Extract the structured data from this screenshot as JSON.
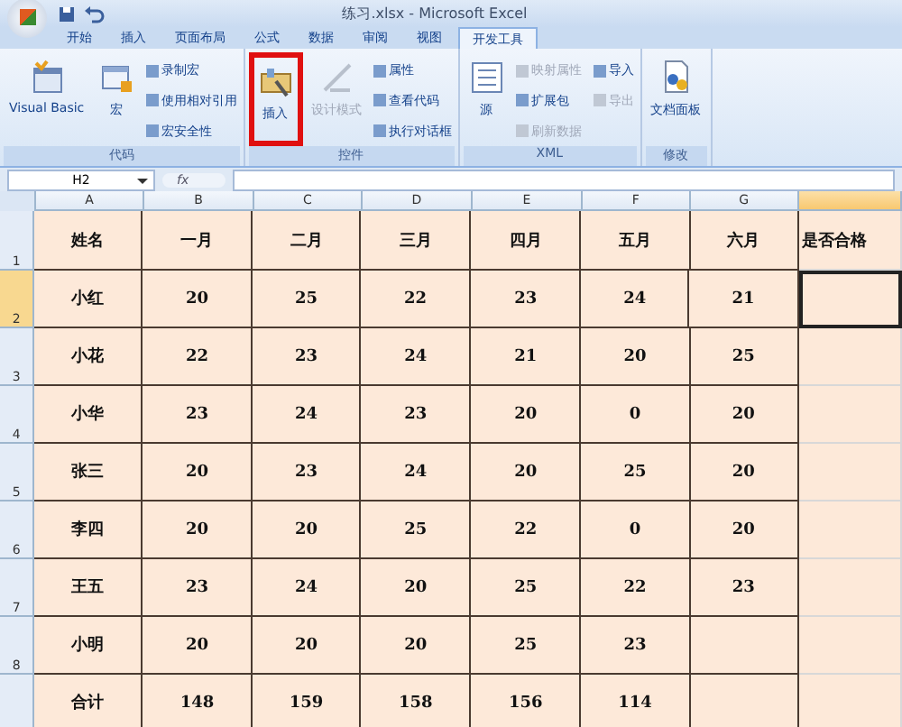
{
  "window": {
    "title": "练习.xlsx - Microsoft Excel"
  },
  "tabs": [
    {
      "label": "开始",
      "selected": false
    },
    {
      "label": "插入",
      "selected": false
    },
    {
      "label": "页面布局",
      "selected": false
    },
    {
      "label": "公式",
      "selected": false
    },
    {
      "label": "数据",
      "selected": false
    },
    {
      "label": "审阅",
      "selected": false
    },
    {
      "label": "视图",
      "selected": false
    },
    {
      "label": "开发工具",
      "selected": true
    }
  ],
  "ribbon_groups": [
    {
      "label": "代码",
      "large": [
        {
          "label": "Visual Basic",
          "highlighted": false,
          "disabled": false
        },
        {
          "label": "宏",
          "highlighted": false,
          "disabled": false
        }
      ],
      "small": [
        {
          "label": "录制宏",
          "disabled": false
        },
        {
          "label": "使用相对引用",
          "disabled": false
        },
        {
          "label": "宏安全性",
          "disabled": false
        }
      ]
    },
    {
      "label": "控件",
      "large": [
        {
          "label": "插入",
          "highlighted": true,
          "disabled": false
        },
        {
          "label": "设计模式",
          "highlighted": false,
          "disabled": true
        }
      ],
      "small": [
        {
          "label": "属性",
          "disabled": false
        },
        {
          "label": "查看代码",
          "disabled": false
        },
        {
          "label": "执行对话框",
          "disabled": false
        }
      ]
    },
    {
      "label": "XML",
      "large": [
        {
          "label": "源",
          "highlighted": false,
          "disabled": false
        }
      ],
      "small": [
        {
          "label": "映射属性",
          "disabled": true
        },
        {
          "label": "扩展包",
          "disabled": false
        },
        {
          "label": "刷新数据",
          "disabled": true
        },
        {
          "label": "导入",
          "disabled": false
        },
        {
          "label": "导出",
          "disabled": true
        }
      ]
    },
    {
      "label": "修改",
      "large": [
        {
          "label": "文档面板",
          "highlighted": false,
          "disabled": false
        }
      ]
    }
  ],
  "formula_bar": {
    "name_box": "H2",
    "fx": "fx"
  },
  "sheet": {
    "columns": [
      {
        "label": "A",
        "selected": false
      },
      {
        "label": "B",
        "selected": false
      },
      {
        "label": "C",
        "selected": false
      },
      {
        "label": "D",
        "selected": false
      },
      {
        "label": "E",
        "selected": false
      },
      {
        "label": "F",
        "selected": false
      },
      {
        "label": "G",
        "selected": false
      },
      {
        "selected": true
      }
    ],
    "rows": [
      {
        "header": "1",
        "selected": false,
        "cells": [
          "姓名",
          "一月",
          "二月",
          "三月",
          "四月",
          "五月",
          "六月",
          "是否合格"
        ]
      },
      {
        "header": "2",
        "selected": true,
        "cells": [
          "小红",
          "20",
          "25",
          "22",
          "23",
          "24",
          "21"
        ]
      },
      {
        "header": "3",
        "selected": false,
        "cells": [
          "小花",
          "22",
          "23",
          "24",
          "21",
          "20",
          "25"
        ]
      },
      {
        "header": "4",
        "selected": false,
        "cells": [
          "小华",
          "23",
          "24",
          "23",
          "20",
          "0",
          "20"
        ]
      },
      {
        "header": "5",
        "selected": false,
        "cells": [
          "张三",
          "20",
          "23",
          "24",
          "20",
          "25",
          "20"
        ]
      },
      {
        "header": "6",
        "selected": false,
        "cells": [
          "李四",
          "20",
          "20",
          "25",
          "22",
          "0",
          "20"
        ]
      },
      {
        "header": "7",
        "selected": false,
        "cells": [
          "王五",
          "23",
          "24",
          "20",
          "25",
          "22",
          "23"
        ]
      },
      {
        "header": "8",
        "selected": false,
        "cells": [
          "小明",
          "20",
          "20",
          "20",
          "25",
          "23"
        ]
      },
      {
        "selected": false,
        "cells": [
          "合计",
          "148",
          "159",
          "158",
          "156",
          "114"
        ]
      }
    ]
  }
}
